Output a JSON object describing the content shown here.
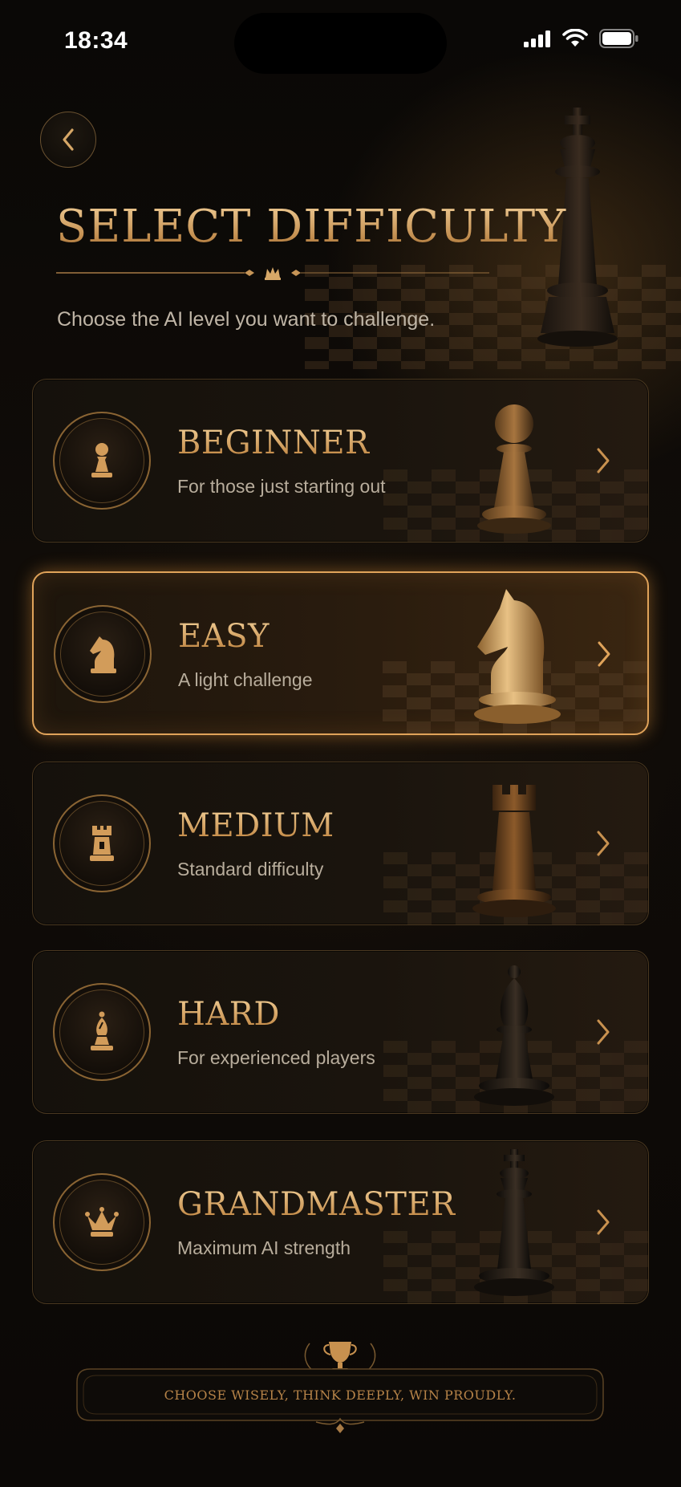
{
  "status_bar": {
    "time": "18:34"
  },
  "header": {
    "title": "SELECT DIFFICULTY",
    "subtitle": "Choose the AI level you want to challenge."
  },
  "levels": [
    {
      "name": "BEGINNER",
      "description": "For those just starting out",
      "icon": "pawn-icon",
      "selected": false
    },
    {
      "name": "EASY",
      "description": "A light challenge",
      "icon": "knight-icon",
      "selected": true
    },
    {
      "name": "MEDIUM",
      "description": "Standard difficulty",
      "icon": "rook-icon",
      "selected": false
    },
    {
      "name": "HARD",
      "description": "For experienced players",
      "icon": "bishop-icon",
      "selected": false
    },
    {
      "name": "GRANDMASTER",
      "description": "Maximum AI strength",
      "icon": "crown-icon",
      "selected": false
    }
  ],
  "footer": {
    "motto": "CHOOSE WISELY, THINK DEEPLY, WIN PROUDLY."
  },
  "colors": {
    "accent_gold": "#d9aa6b",
    "selected_glow": "#e0a35a",
    "background": "#0b0907"
  }
}
